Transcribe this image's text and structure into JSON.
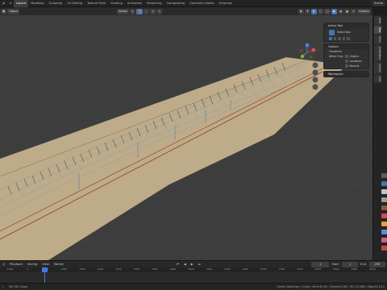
{
  "workspace_tabs": [
    "Layout",
    "Modeling",
    "Sculpting",
    "UV Editing",
    "Texture Paint",
    "Shading",
    "Animation",
    "Rendering",
    "Compositing",
    "Geometry Nodes",
    "Scripting"
  ],
  "scene_name": "Scene",
  "header": {
    "mode": "Object",
    "orientation": "Global",
    "options": "Options"
  },
  "sidebar_tabs": [
    "Item",
    "Tool",
    "View",
    "Animation",
    "Create",
    "Edit"
  ],
  "npanel": {
    "active_tool_title": "Active Tool",
    "active_tool_name": "Select Box",
    "options_title": "Options",
    "transform_title": "Transform",
    "affect_label": "Affect Only",
    "affect_items": [
      "Origins",
      "Locations",
      "Parents"
    ],
    "workspace_title": "Workspace"
  },
  "timeline": {
    "menus": [
      "Playback",
      "Keying",
      "View",
      "Marker"
    ],
    "current_frame": "1",
    "start_label": "Start",
    "start_value": "1",
    "end_label": "End",
    "end_value": "250",
    "ticks": [
      "-1000",
      "0",
      "500",
      "1000",
      "1500",
      "2000",
      "2500",
      "3000",
      "3500",
      "4000",
      "4500",
      "5000",
      "5500",
      "6000",
      "6500",
      "7000",
      "7500",
      "8000",
      "8500",
      "9000",
      "9500"
    ]
  },
  "statusbar": {
    "left": "Set 3D Cursor",
    "right": "Scene Collection | Cube | Verts:8,192 | Faces:6,144 | Tris:12,288 | Objects:1/12"
  },
  "colors": {
    "accent": "#4772b3",
    "playhead": "#3f7be0",
    "ground": "#c9b48f",
    "ground_line": "#8e3a22"
  }
}
